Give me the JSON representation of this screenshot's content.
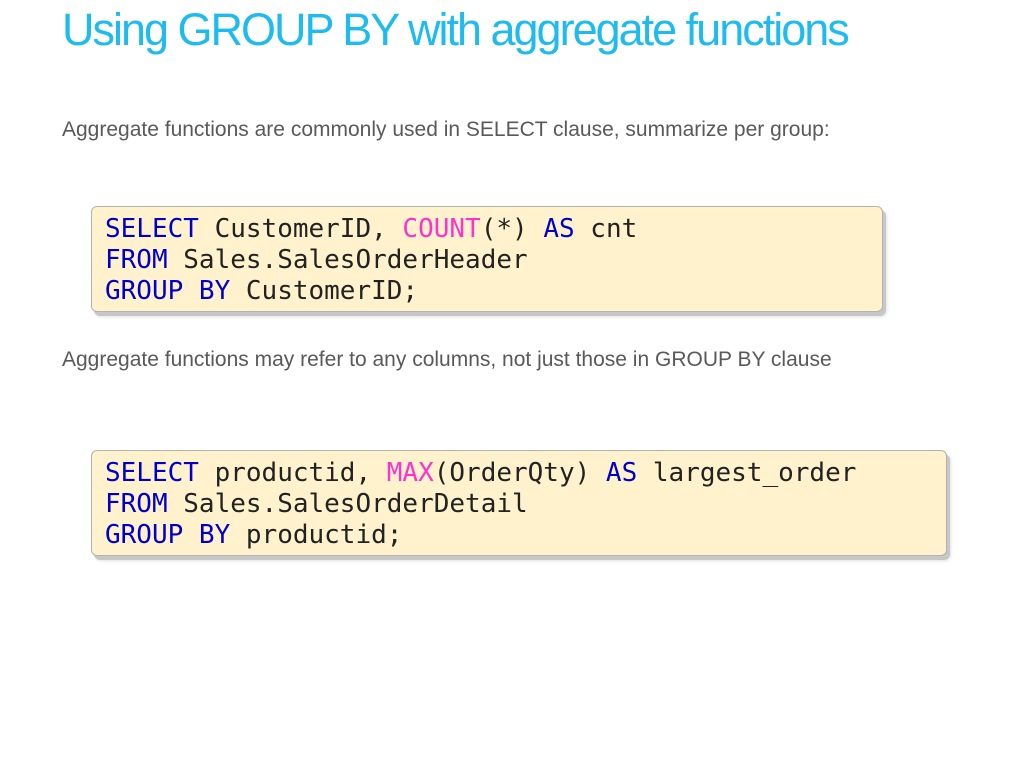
{
  "slide": {
    "title": "Using GROUP BY with aggregate functions",
    "paragraph_1": "Aggregate functions are commonly used in SELECT clause, summarize per group:",
    "paragraph_2": "Aggregate functions may refer to any columns, not just those in GROUP BY clause"
  },
  "code_1": {
    "line_1": {
      "select_kw": "SELECT",
      "cols": " CustomerID, ",
      "count_fn": "COUNT",
      "count_arg": "(*) ",
      "as_kw": "AS",
      "alias": " cnt"
    },
    "line_2": {
      "from_kw": "FROM",
      "table": " Sales.SalesOrderHeader"
    },
    "line_3": {
      "group_kw": "GROUP BY",
      "group_col": " CustomerID;"
    }
  },
  "code_2": {
    "line_1": {
      "select_kw": "SELECT",
      "cols": " productid, ",
      "max_fn": "MAX",
      "max_arg": "(OrderQty) ",
      "as_kw": "AS",
      "alias": " largest_order"
    },
    "line_2": {
      "from_kw": "FROM",
      "table": " Sales.SalesOrderDetail"
    },
    "line_3": {
      "group_kw": "GROUP BY",
      "group_col": " productid;"
    }
  },
  "colors": {
    "title": "#1ebbee",
    "body_text": "#595959",
    "keyword": "#0000cc",
    "function": "#ff33cc",
    "code_background": "#fff2cc"
  }
}
